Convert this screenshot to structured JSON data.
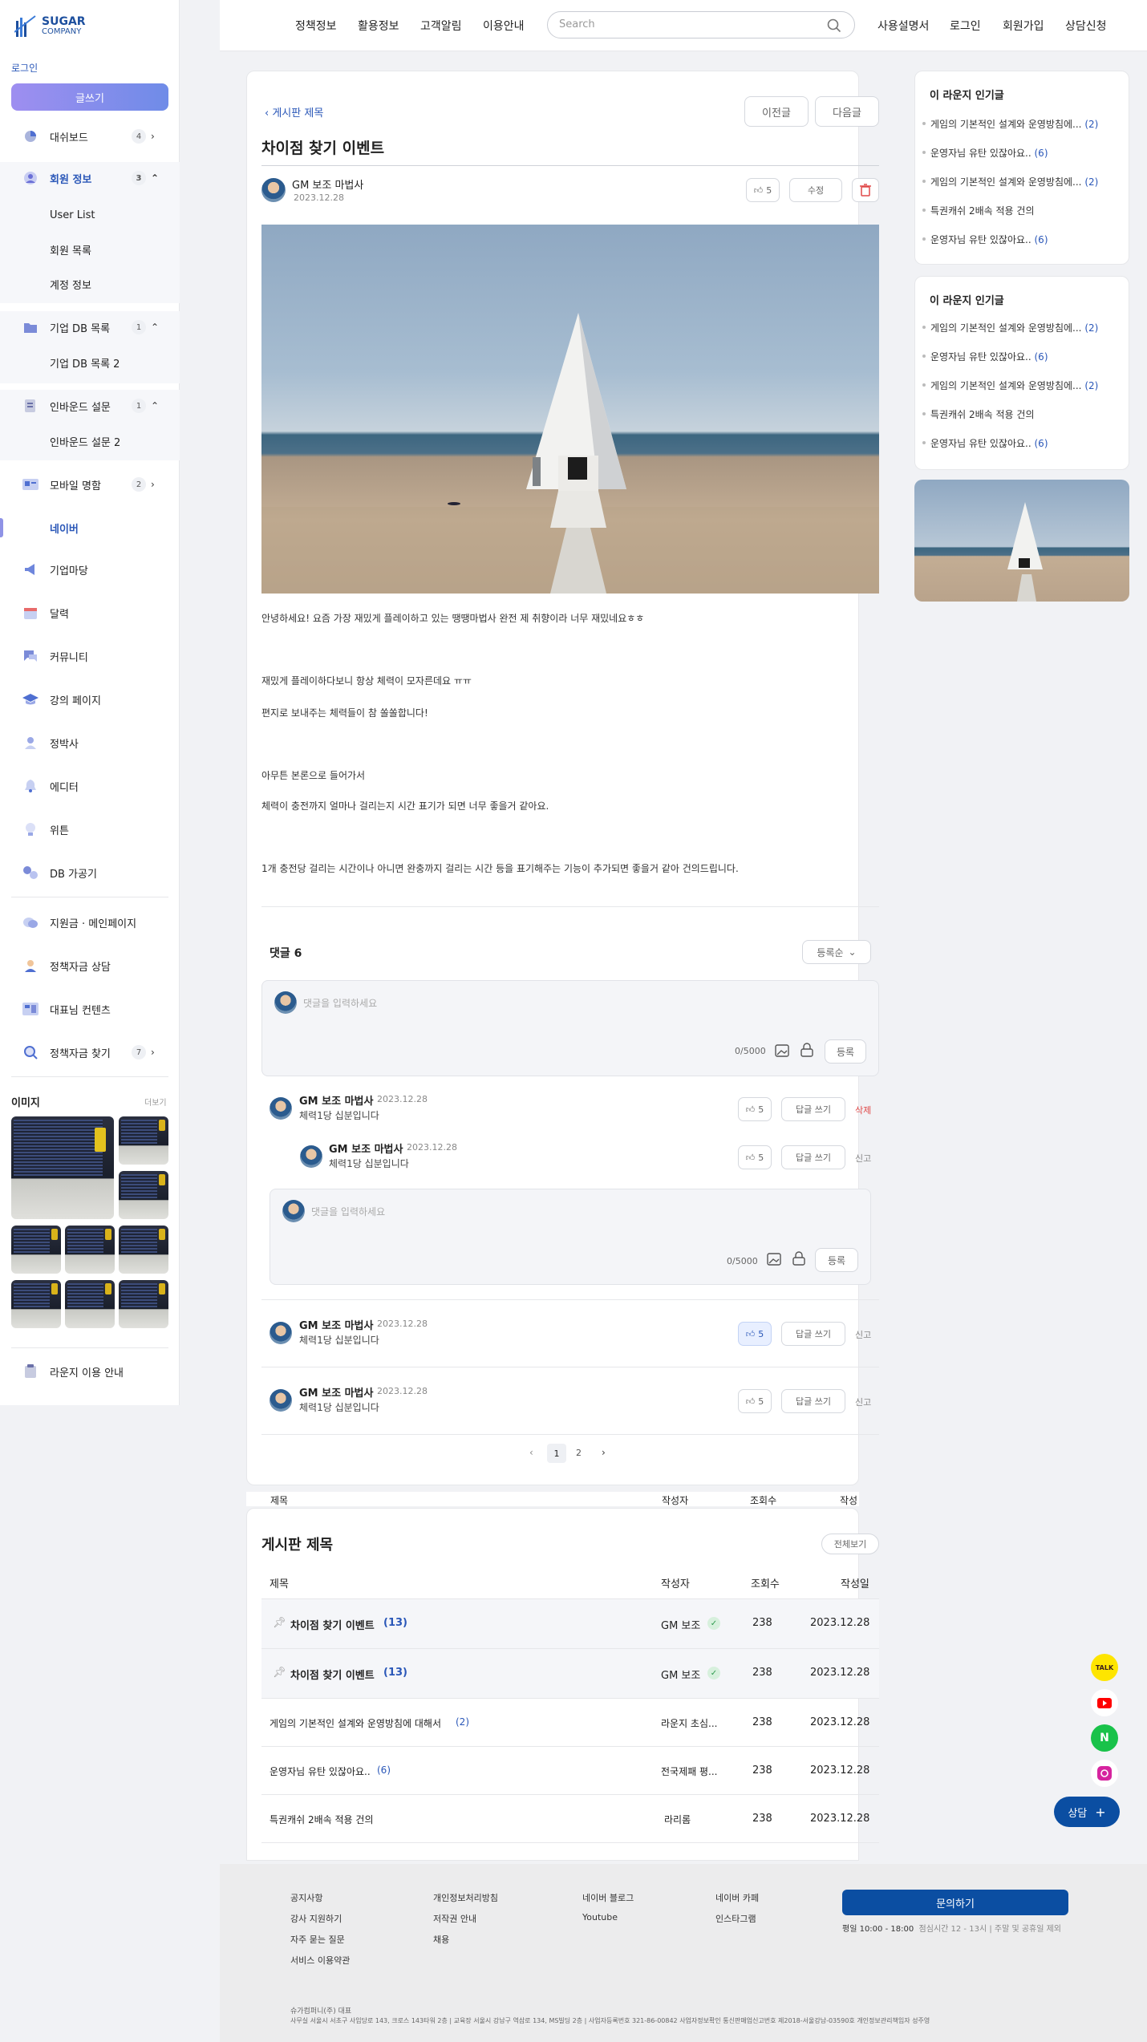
{
  "brand": {
    "name": "SUGAR",
    "sub": "COMPANY"
  },
  "sidebar": {
    "login": "로그인",
    "write": "글쓰기",
    "items": [
      {
        "label": "대쉬보드",
        "count": "4",
        "arrow": "›"
      },
      {
        "label": "회원 정보",
        "count": "3",
        "arrow": "⌃"
      },
      {
        "label": "User List"
      },
      {
        "label": "회원 목록"
      },
      {
        "label": "계정 정보"
      },
      {
        "label": "기업 DB 목록",
        "count": "1",
        "arrow": "⌃"
      },
      {
        "label": "기업 DB 목록 2"
      },
      {
        "label": "인바운드 설문",
        "count": "1",
        "arrow": "⌃"
      },
      {
        "label": "인바운드 설문 2"
      },
      {
        "label": "모바일 명함",
        "count": "2",
        "arrow": "›"
      },
      {
        "label": "네이버"
      },
      {
        "label": "기업마당"
      },
      {
        "label": "달력"
      },
      {
        "label": "커뮤니티"
      },
      {
        "label": "강의 페이지"
      },
      {
        "label": "정박사"
      },
      {
        "label": "에디터"
      },
      {
        "label": "위튼"
      },
      {
        "label": "DB 가공기"
      },
      {
        "label": "지원금 · 메인페이지"
      },
      {
        "label": "정책자금 상담"
      },
      {
        "label": "대표님 컨텐츠"
      },
      {
        "label": "정책자금 찾기",
        "count": "7",
        "arrow": "›"
      },
      {
        "label": "라운지 이용 안내"
      }
    ],
    "images_title": "이미지",
    "images_more": "더보기"
  },
  "topnav": {
    "items": [
      "정책정보",
      "활용정보",
      "고객알림",
      "이용안내"
    ],
    "search_placeholder": "Search",
    "right": [
      "사용설명서",
      "로그인",
      "회원가입",
      "상담신청"
    ]
  },
  "post": {
    "back": "게시판 제목",
    "prev": "이전글",
    "next": "다음글",
    "title": "차이점 찾기 이벤트",
    "author": "GM 보조 마법사",
    "date": "2023.12.28",
    "likes": "5",
    "edit": "수정",
    "paragraphs": [
      "안녕하세요! 요즘 가장  재밌게 플레이하고 있는 땡땡마법사 완전 제 취향이라 너무 재밌네요ㅎㅎ",
      "재밌게 플레이하다보니 항상 체력이 모자른데요 ㅠㅠ",
      "편지로 보내주는 체력들이 참 쏠쏠합니다!",
      "아무튼 본론으로 들어가서",
      "체력이 충전까지 얼마나 걸리는지 시간 표기가 되면 너무 좋을거 같아요.",
      "1개 충전당 걸리는 시간이나 아니면 완충까지 걸리는 시간 등을 표기해주는 기능이 추가되면 좋을거 같아 건의드립니다."
    ]
  },
  "comments": {
    "title": "댓글 6",
    "sort": "등록순",
    "placeholder": "댓글을 입력하세요",
    "counter": "0/5000",
    "submit": "등록",
    "reply": "답글 쓰기",
    "delete": "삭제",
    "report": "신고",
    "list": [
      {
        "name": "GM 보조 마법사",
        "date": "2023.12.28",
        "body": "체력1당 십분입니다",
        "likes": "5"
      },
      {
        "name": "GM 보조 마법사",
        "date": "2023.12.28",
        "body": "체력1당 십분입니다",
        "likes": "5"
      },
      {
        "name": "GM 보조 마법사",
        "date": "2023.12.28",
        "body": "체력1당 십분입니다",
        "likes": "5"
      },
      {
        "name": "GM 보조 마법사",
        "date": "2023.12.28",
        "body": "체력1당 십분입니다",
        "likes": "5"
      }
    ],
    "pages": [
      "1",
      "2"
    ]
  },
  "board": {
    "title": "게시판 제목",
    "view_all": "전체보기",
    "headers": [
      "제목",
      "작성자",
      "조회수",
      "작성일"
    ],
    "rows": [
      {
        "title": "차이점 찾기 이벤트",
        "count": "(13)",
        "author": "GM 보조",
        "views": "238",
        "date": "2023.12.28"
      },
      {
        "title": "차이점 찾기 이벤트",
        "count": "(13)",
        "author": "GM 보조",
        "views": "238",
        "date": "2023.12.28"
      },
      {
        "title": "게임의 기본적인 설계와 운영방침에 대해서",
        "count": "(2)",
        "author": "라운지 초심...",
        "views": "238",
        "date": "2023.12.28"
      },
      {
        "title": "운영자님 유탄 있잖아요..",
        "count": "(6)",
        "author": "전국제패 평...",
        "views": "238",
        "date": "2023.12.28"
      },
      {
        "title": "특권캐쉬 2배속 적용 건의",
        "count": "",
        "author": "라리롬",
        "views": "238",
        "date": "2023.12.28"
      }
    ]
  },
  "popular": {
    "title": "이 라운지 인기글",
    "items": [
      {
        "text": "게임의 기본적인 설계와 운영방침에...",
        "count": "(2)"
      },
      {
        "text": "운영자님 유탄 있잖아요..",
        "count": "(6)"
      },
      {
        "text": "게임의 기본적인 설계와 운영방침에...",
        "count": "(2)"
      },
      {
        "text": "특권캐쉬 2배속 적용 건의",
        "count": ""
      },
      {
        "text": "운영자님 유탄 있잖아요..",
        "count": "(6)"
      }
    ]
  },
  "footer": {
    "col1": [
      "공지사항",
      "강사 지원하기",
      "자주 묻는 질문",
      "서비스 이용약관"
    ],
    "col2": [
      "개인정보처리방침",
      "저작권 안내",
      "채용"
    ],
    "col3": [
      "네이버 블로그",
      "Youtube"
    ],
    "col4": [
      "네이버 카페",
      "인스타그램"
    ],
    "contact": "문의하기",
    "hours": "평일 10:00 - 18:00",
    "hours_note": "점심시간 12 - 13시 | 주말 및 공휴일 제외",
    "company": "슈가컴퍼니(주) 대표",
    "address": "사무실 서울시 서초구 사임당로 143, 크로스 143타워 2층 | 교육장 서울시 강남구 역삼로 134, MS빌딩 2층 | 사업자등록번호 321-86-00842 사업자정보확인 통신판매업신고번호 제2018-서울강남-03590호 개인정보관리책임자 성주영"
  },
  "floating": {
    "kakao": "TALK",
    "naver": "N",
    "consult": "상담"
  }
}
